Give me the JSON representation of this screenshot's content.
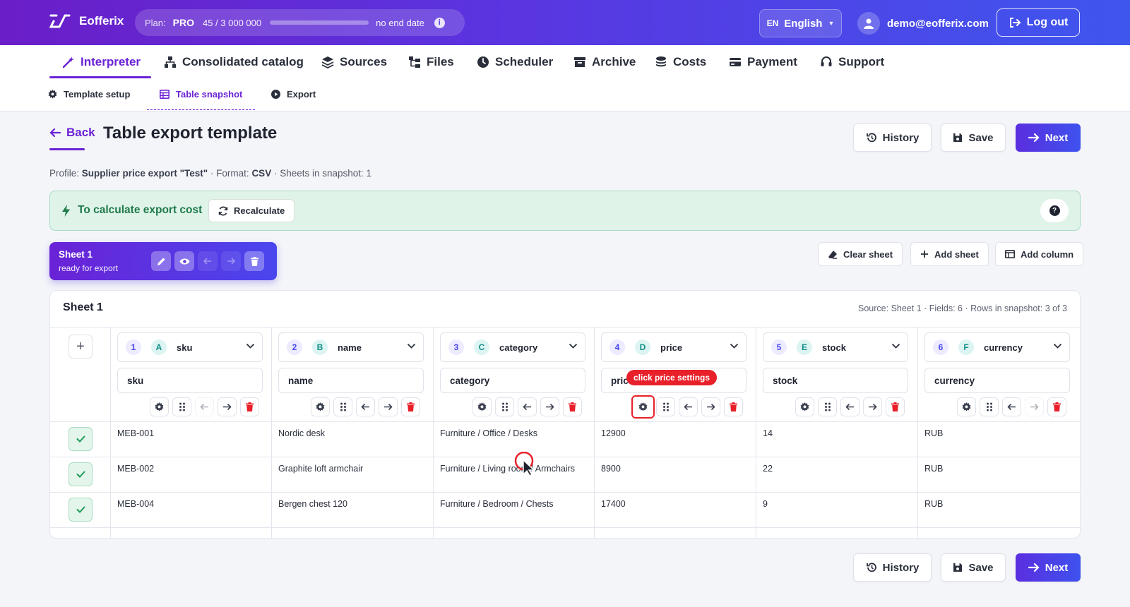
{
  "app": {
    "name": "Eofferix"
  },
  "plan": {
    "label": "Plan:",
    "tier": "PRO",
    "usage": "45 / 3 000 000",
    "usage_fraction": 1.5e-05,
    "end_date": "no end date"
  },
  "language": {
    "code": "EN",
    "name": "English"
  },
  "user": {
    "email": "demo@eofferix.com",
    "logout_label": "Log out"
  },
  "nav": {
    "items": [
      {
        "label": "Interpreter",
        "icon": "magic-wand-icon",
        "active": true
      },
      {
        "label": "Consolidated catalog",
        "icon": "sitemap-icon"
      },
      {
        "label": "Sources",
        "icon": "layers-icon"
      },
      {
        "label": "Files",
        "icon": "folder-tree-icon"
      },
      {
        "label": "Scheduler",
        "icon": "clock-icon"
      },
      {
        "label": "Archive",
        "icon": "archive-box-icon"
      },
      {
        "label": "Costs",
        "icon": "coins-icon"
      },
      {
        "label": "Payment",
        "icon": "credit-card-icon"
      },
      {
        "label": "Support",
        "icon": "headset-icon"
      }
    ]
  },
  "subnav": {
    "items": [
      {
        "label": "Template setup",
        "icon": "gear-icon"
      },
      {
        "label": "Table snapshot",
        "icon": "table-icon",
        "active": true
      },
      {
        "label": "Export",
        "icon": "play-circle-icon"
      }
    ]
  },
  "page": {
    "back_label": "Back",
    "title": "Table export template",
    "history_label": "History",
    "save_label": "Save",
    "next_label": "Next",
    "profile_prefix": "Profile:",
    "profile_name": "Supplier price export \"Test\"",
    "format_prefix": "· Format:",
    "format": "CSV",
    "sheets_text": "· Sheets in snapshot: 1"
  },
  "alert": {
    "text": "To calculate export cost",
    "recalculate_label": "Recalculate",
    "help_icon": "?"
  },
  "sheet_tab": {
    "name": "Sheet 1",
    "status": "ready for export"
  },
  "toolbar": {
    "clear_sheet": "Clear sheet",
    "add_sheet": "Add sheet",
    "add_column": "Add column"
  },
  "table": {
    "title": "Sheet 1",
    "meta": "Source: Sheet 1 · Fields: 6 · Rows in snapshot: 3 of 3",
    "add_symbol": "+",
    "columns": [
      {
        "num": "1",
        "letter": "A",
        "field": "sku",
        "header": "sku"
      },
      {
        "num": "2",
        "letter": "B",
        "field": "name",
        "header": "name"
      },
      {
        "num": "3",
        "letter": "C",
        "field": "category",
        "header": "category"
      },
      {
        "num": "4",
        "letter": "D",
        "field": "price",
        "header": "price"
      },
      {
        "num": "5",
        "letter": "E",
        "field": "stock",
        "header": "stock"
      },
      {
        "num": "6",
        "letter": "F",
        "field": "currency",
        "header": "currency"
      }
    ],
    "rows": [
      {
        "cells": [
          "MEB-001",
          "Nordic desk",
          "Furniture / Office / Desks",
          "12900",
          "14",
          "RUB"
        ]
      },
      {
        "cells": [
          "MEB-002",
          "Graphite loft armchair",
          "Furniture / Living room / Armchairs",
          "8900",
          "22",
          "RUB"
        ]
      },
      {
        "cells": [
          "MEB-004",
          "Bergen chest 120",
          "Furniture / Bedroom / Chests",
          "17400",
          "9",
          "RUB"
        ]
      }
    ]
  },
  "annotation": {
    "tooltip": "click price settings"
  },
  "colors": {
    "brand_start": "#6a1ec8",
    "brand_end": "#3f56ee",
    "accent": "#6a22d6",
    "success_bg": "#dff3e9",
    "success_text": "#1f7a4a",
    "danger": "#e8202a"
  }
}
